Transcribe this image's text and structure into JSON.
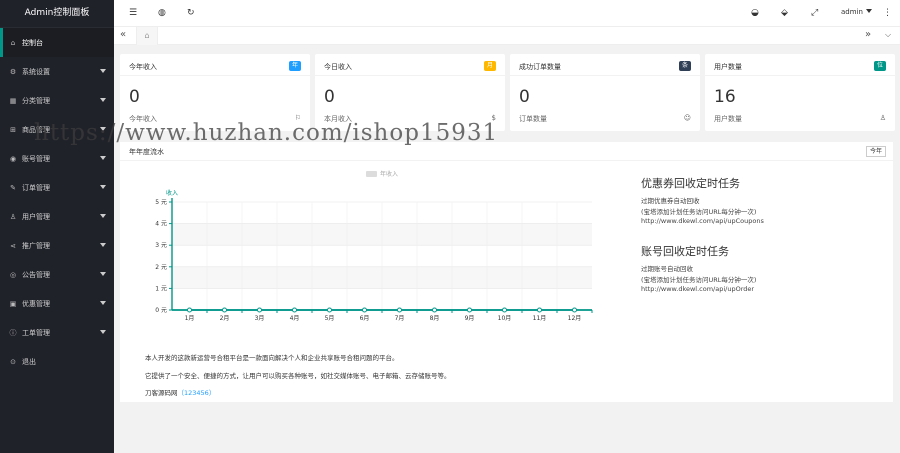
{
  "sidebar": {
    "title": "Admin控制面板",
    "items": [
      {
        "icon": "home-icon",
        "glyph": "⌂",
        "label": "控制台",
        "has_arrow": false
      },
      {
        "icon": "gear-icon",
        "glyph": "⚙",
        "label": "系统设置",
        "has_arrow": true
      },
      {
        "icon": "grid-icon",
        "glyph": "▦",
        "label": "分类管理",
        "has_arrow": true
      },
      {
        "icon": "cart-icon",
        "glyph": "⊞",
        "label": "商品管理",
        "has_arrow": true
      },
      {
        "icon": "account-icon",
        "glyph": "◉",
        "label": "账号管理",
        "has_arrow": true
      },
      {
        "icon": "order-icon",
        "glyph": "✎",
        "label": "订单管理",
        "has_arrow": true
      },
      {
        "icon": "user-icon",
        "glyph": "♙",
        "label": "用户管理",
        "has_arrow": true
      },
      {
        "icon": "share-icon",
        "glyph": "⋖",
        "label": "推广管理",
        "has_arrow": true
      },
      {
        "icon": "notice-icon",
        "glyph": "◎",
        "label": "公告管理",
        "has_arrow": true
      },
      {
        "icon": "coupon-icon",
        "glyph": "▣",
        "label": "优惠管理",
        "has_arrow": true
      },
      {
        "icon": "ticket-icon",
        "glyph": "ⓘ",
        "label": "工单管理",
        "has_arrow": true
      },
      {
        "icon": "logout-icon",
        "glyph": "⊙",
        "label": "退出",
        "has_arrow": false
      }
    ]
  },
  "topbar": {
    "user": "admin",
    "icons": [
      "menu-icon",
      "globe-icon",
      "refresh-icon",
      "theme-icon",
      "tag-icon",
      "fullscreen-icon"
    ]
  },
  "tabs": {
    "home_icon": "home-icon",
    "prev": "«",
    "next": "»"
  },
  "cards": [
    {
      "title": "今年收入",
      "badge": "年",
      "badge_color": "#1e9fff",
      "value": "0",
      "sub": "今年收入",
      "icon": "flag-icon",
      "glyph": "⚐"
    },
    {
      "title": "今日收入",
      "badge": "月",
      "badge_color": "#ffb800",
      "value": "0",
      "sub": "本月收入",
      "icon": "money-icon",
      "glyph": "$"
    },
    {
      "title": "成功订单数量",
      "badge": "条",
      "badge_color": "#2f4056",
      "value": "0",
      "sub": "订单数量",
      "icon": "smile-icon",
      "glyph": "☺"
    },
    {
      "title": "用户数量",
      "badge": "位",
      "badge_color": "#009688",
      "value": "16",
      "sub": "用户数量",
      "icon": "users-icon",
      "glyph": "♙"
    }
  ],
  "panel": {
    "title": "年年度流水",
    "button": "今年"
  },
  "chart_data": {
    "type": "line",
    "legend": "年收入",
    "series": [
      {
        "name": "年收入",
        "values": [
          0,
          0,
          0,
          0,
          0,
          0,
          0,
          0,
          0,
          0,
          0,
          0
        ]
      }
    ],
    "categories": [
      "1月",
      "2月",
      "3月",
      "4月",
      "5月",
      "6月",
      "7月",
      "8月",
      "9月",
      "10月",
      "11月",
      "12月"
    ],
    "ylabel": "收入",
    "yticks": [
      "0 元",
      "1 元",
      "2 元",
      "3 元",
      "4 元",
      "5 元"
    ],
    "ylim": [
      0,
      5
    ],
    "color": "#009688",
    "grid": true
  },
  "tasks": [
    {
      "heading": "优惠券回收定时任务",
      "lines": [
        "过期优惠券自动回收",
        "(宝塔添加计划任务访问URL每分钟一次)",
        "http://www.dkewl.com/api/upCoupons"
      ]
    },
    {
      "heading": "账号回收定时任务",
      "lines": [
        "过期账号自动回收",
        "(宝塔添加计划任务访问URL每分钟一次)",
        "http://www.dkewl.com/api/upOrder"
      ]
    }
  ],
  "description": {
    "line1": "本人开发的这款新运营号合租平台是一款面向解决个人和企业共享账号合租问题的平台。",
    "line2": "它提供了一个安全、便捷的方式，让用户可以购买各种账号，如社交媒体账号、电子邮箱、云存储账号等。",
    "line3_prefix": "刀客源码网",
    "line3_link": "（123456）"
  },
  "watermark": "https://www.huzhan.com/ishop15931"
}
